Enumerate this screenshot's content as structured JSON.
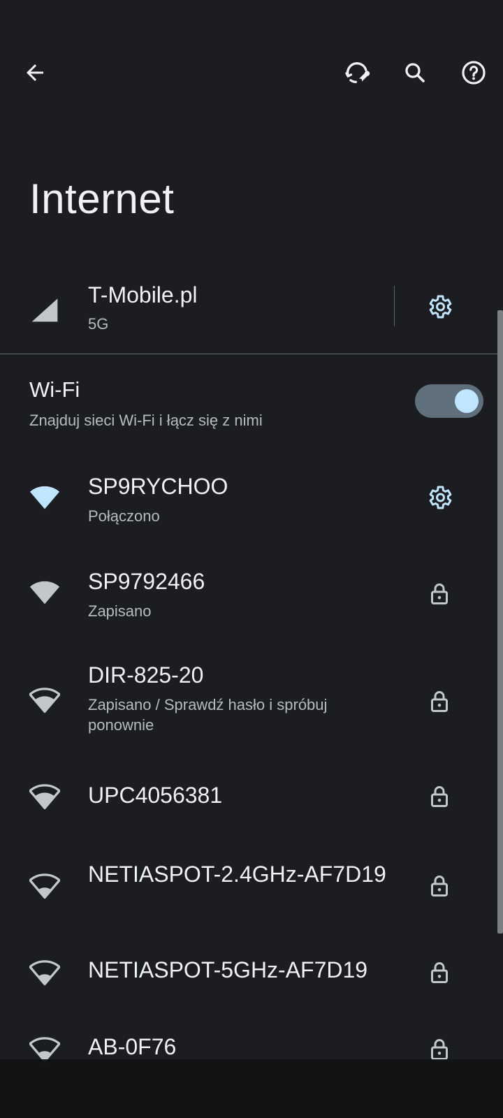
{
  "header": {
    "back_icon": "back-arrow-icon",
    "actions": [
      {
        "name": "network-reset-icon"
      },
      {
        "name": "search-icon"
      },
      {
        "name": "help-icon"
      }
    ]
  },
  "page_title": "Internet",
  "mobile": {
    "name": "T-Mobile.pl",
    "type": "5G",
    "settings_icon": "gear-icon"
  },
  "wifi": {
    "title": "Wi-Fi",
    "subtitle": "Znajduj sieci Wi-Fi i łącz się z nimi",
    "enabled": true
  },
  "networks": [
    {
      "ssid": "SP9RYCHOO",
      "status": "Połączono",
      "trailing": "gear-icon"
    },
    {
      "ssid": "SP9792466",
      "status": "Zapisano",
      "trailing": "lock-icon"
    },
    {
      "ssid": "DIR-825-20",
      "status": "Zapisano / Sprawdź hasło i spróbuj ponownie",
      "trailing": "lock-icon"
    },
    {
      "ssid": "UPC4056381",
      "status": "",
      "trailing": "lock-icon"
    },
    {
      "ssid": "NETIASPOT-2.4GHz-AF7D19",
      "status": "",
      "trailing": "lock-icon"
    },
    {
      "ssid": "NETIASPOT-5GHz-AF7D19",
      "status": "",
      "trailing": "lock-icon"
    },
    {
      "ssid": "AB-0F76",
      "status": "",
      "trailing": "lock-icon"
    }
  ],
  "colors": {
    "background": "#1b1d20",
    "accent": "#bfe5ff",
    "text_primary": "#f1f2f4",
    "text_secondary": "#b7bbc1"
  }
}
